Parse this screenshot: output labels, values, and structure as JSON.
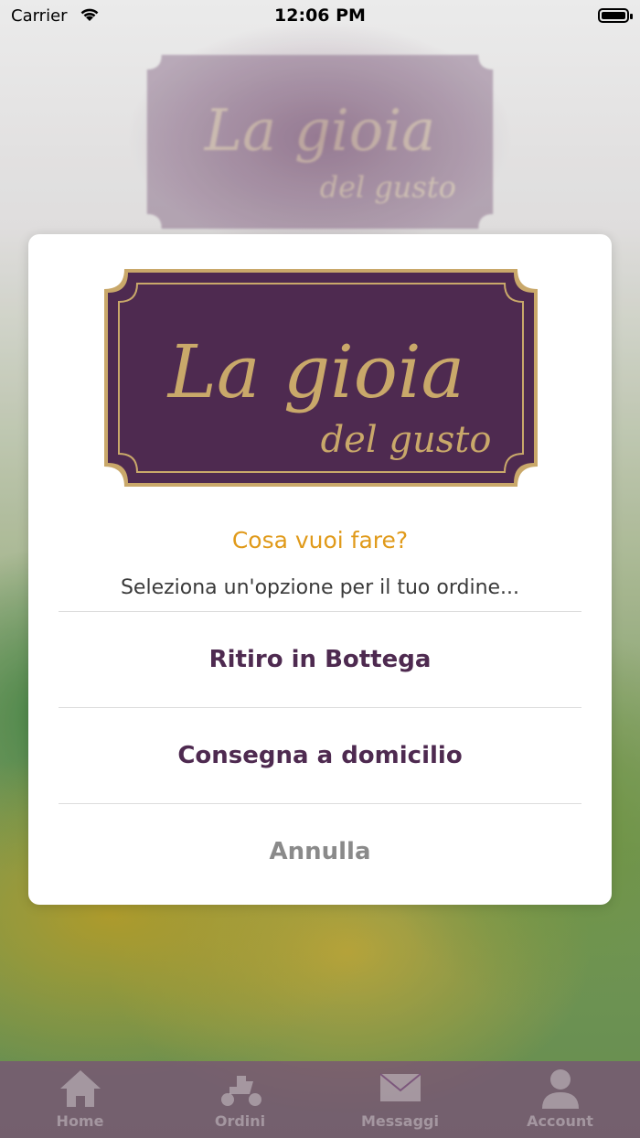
{
  "status_bar": {
    "carrier": "Carrier",
    "time": "12:06 PM"
  },
  "brand": {
    "line1": "La gioia",
    "line2": "del gusto"
  },
  "dialog": {
    "title": "Cosa vuoi fare?",
    "subtitle": "Seleziona un'opzione per il tuo ordine...",
    "options": [
      {
        "label": "Ritiro in Bottega"
      },
      {
        "label": "Consegna a domicilio"
      }
    ],
    "cancel_label": "Annulla"
  },
  "tab_bar": {
    "tabs": [
      {
        "label": "Home",
        "icon": "home-icon"
      },
      {
        "label": "Ordini",
        "icon": "scooter-icon"
      },
      {
        "label": "Messaggi",
        "icon": "envelope-icon"
      },
      {
        "label": "Account",
        "icon": "user-icon"
      }
    ]
  },
  "colors": {
    "brand_purple": "#4e2a50",
    "brand_gold": "#c9a86a",
    "accent_orange": "#e09a1a",
    "cancel_gray": "#8a8a8a"
  }
}
